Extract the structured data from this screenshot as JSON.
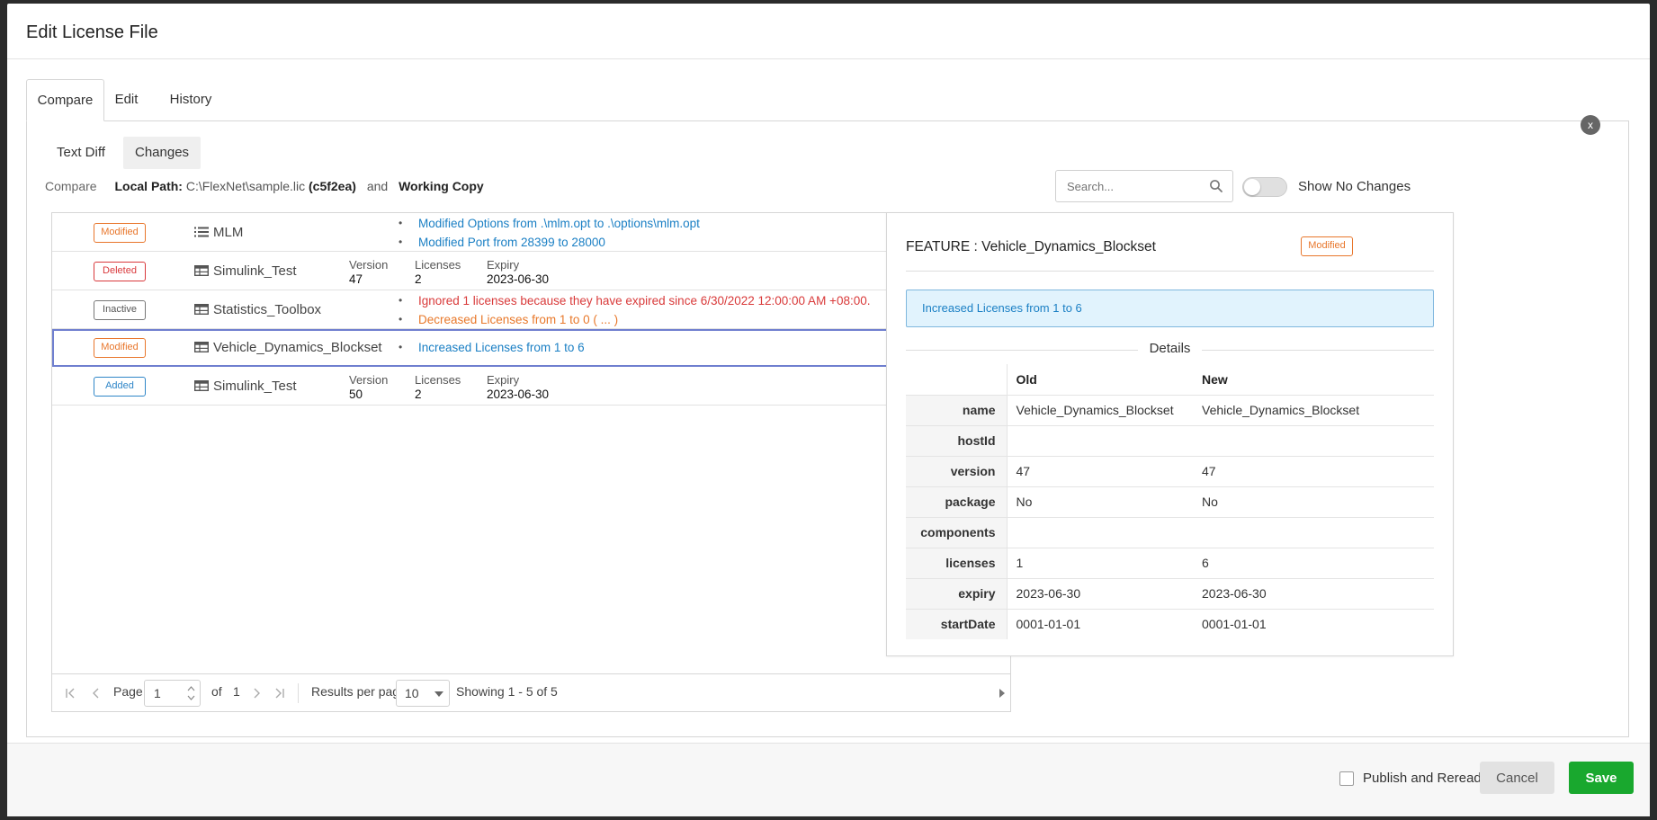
{
  "dialog": {
    "title": "Edit License File"
  },
  "tabs": [
    {
      "label": "Compare",
      "active": true
    },
    {
      "label": "Edit",
      "active": false
    },
    {
      "label": "History",
      "active": false
    }
  ],
  "subtabs": [
    {
      "label": "Text Diff",
      "selected": false
    },
    {
      "label": "Changes",
      "selected": true
    }
  ],
  "compare": {
    "prefix": "Compare",
    "local_label": "Local Path:",
    "local_path": "C:\\FlexNet\\sample.lic",
    "hash": "(c5f2ea)",
    "and": "and",
    "working": "Working Copy"
  },
  "search": {
    "placeholder": "Search...",
    "icon": "search-icon"
  },
  "toggle": {
    "label": "Show No Changes",
    "on": false
  },
  "colors": {
    "modified": "#e8762b",
    "deleted": "#d9393c",
    "added": "#2f86c8",
    "info": "#1a7fc4",
    "save": "#19a82e",
    "selection": "#6f7fcf"
  },
  "changes": [
    {
      "status": "Modified",
      "icon": "list-icon",
      "name": "MLM",
      "bullets": [
        {
          "text": "Modified Options from .\\mlm.opt to .\\options\\mlm.opt",
          "color": "blue"
        },
        {
          "text": "Modified Port from 28399 to 28000",
          "color": "blue"
        }
      ]
    },
    {
      "status": "Deleted",
      "icon": "table-icon",
      "name": "Simulink_Test",
      "meta": {
        "version_label": "Version",
        "version": "47",
        "licenses_label": "Licenses",
        "licenses": "2",
        "expiry_label": "Expiry",
        "expiry": "2023-06-30"
      }
    },
    {
      "status": "Inactive",
      "icon": "table-icon",
      "name": "Statistics_Toolbox",
      "bullets": [
        {
          "text": "Ignored 1 licenses because they have expired since 6/30/2022 12:00:00 AM +08:00.",
          "color": "red"
        },
        {
          "text": "Decreased Licenses from 1 to 0   ( ... )",
          "color": "orange"
        }
      ]
    },
    {
      "status": "Modified",
      "icon": "table-icon",
      "name": "Vehicle_Dynamics_Blockset",
      "selected": true,
      "bullets": [
        {
          "text": "Increased Licenses from 1 to 6",
          "color": "blue"
        }
      ]
    },
    {
      "status": "Added",
      "icon": "table-icon",
      "name": "Simulink_Test",
      "meta": {
        "version_label": "Version",
        "version": "50",
        "licenses_label": "Licenses",
        "licenses": "2",
        "expiry_label": "Expiry",
        "expiry": "2023-06-30"
      }
    }
  ],
  "pager": {
    "page_label": "Page",
    "page": "1",
    "of_label": "of",
    "total_pages": "1",
    "per_page_label": "Results per page",
    "per_page": "10",
    "showing": "Showing 1 - 5 of 5"
  },
  "detail": {
    "close": "x",
    "title": "FEATURE : Vehicle_Dynamics_Blockset",
    "badge": "Modified",
    "info": "Increased Licenses from 1 to 6",
    "section": "Details",
    "col_old": "Old",
    "col_new": "New",
    "rows": [
      {
        "key": "name",
        "old": "Vehicle_Dynamics_Blockset",
        "new": "Vehicle_Dynamics_Blockset"
      },
      {
        "key": "hostId",
        "old": "",
        "new": ""
      },
      {
        "key": "version",
        "old": "47",
        "new": "47"
      },
      {
        "key": "package",
        "old": "No",
        "new": "No"
      },
      {
        "key": "components",
        "old": "",
        "new": ""
      },
      {
        "key": "licenses",
        "old": "1",
        "new": "6"
      },
      {
        "key": "expiry",
        "old": "2023-06-30",
        "new": "2023-06-30"
      },
      {
        "key": "startDate",
        "old": "0001-01-01",
        "new": "0001-01-01"
      }
    ]
  },
  "footer": {
    "publish_label": "Publish and Reread",
    "publish_checked": false,
    "cancel": "Cancel",
    "save": "Save"
  }
}
